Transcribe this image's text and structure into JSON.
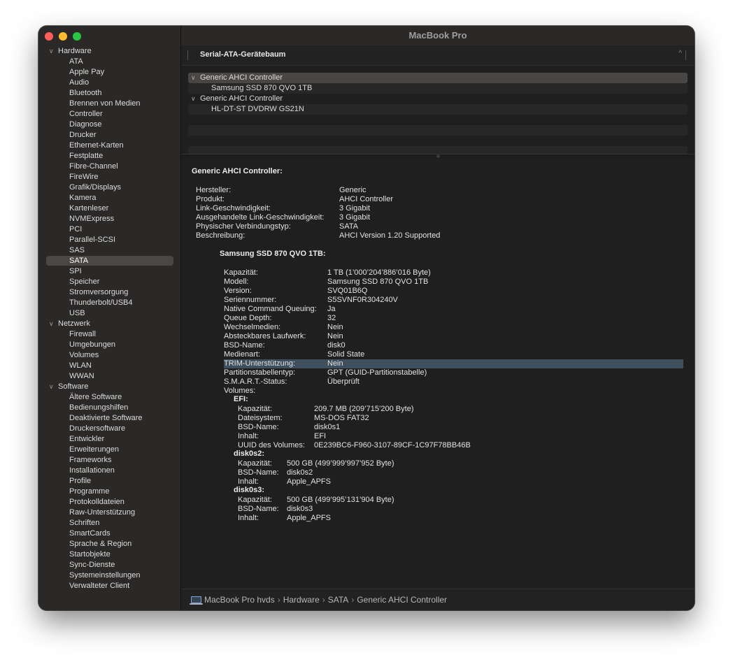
{
  "window": {
    "title": "MacBook Pro"
  },
  "sidebar": {
    "sections": [
      {
        "label": "Hardware",
        "items": [
          "ATA",
          "Apple Pay",
          "Audio",
          "Bluetooth",
          "Brennen von Medien",
          "Controller",
          "Diagnose",
          "Drucker",
          "Ethernet-Karten",
          "Festplatte",
          "Fibre-Channel",
          "FireWire",
          "Grafik/Displays",
          "Kamera",
          "Kartenleser",
          "NVMExpress",
          "PCI",
          "Parallel-SCSI",
          "SAS",
          "SATA",
          "SPI",
          "Speicher",
          "Stromversorgung",
          "Thunderbolt/USB4",
          "USB"
        ]
      },
      {
        "label": "Netzwerk",
        "items": [
          "Firewall",
          "Umgebungen",
          "Volumes",
          "WLAN",
          "WWAN"
        ]
      },
      {
        "label": "Software",
        "items": [
          "Ältere Software",
          "Bedienungshilfen",
          "Deaktivierte Software",
          "Druckersoftware",
          "Entwickler",
          "Erweiterungen",
          "Frameworks",
          "Installationen",
          "Profile",
          "Programme",
          "Protokolldateien",
          "Raw-Unterstützung",
          "Schriften",
          "SmartCards",
          "Sprache & Region",
          "Startobjekte",
          "Sync-Dienste",
          "Systemeinstellungen",
          "Verwalteter Client"
        ]
      }
    ],
    "selected": "SATA"
  },
  "tree_header": {
    "title": "Serial-ATA-Gerätebaum",
    "caret": "^"
  },
  "device_tree": [
    {
      "label": "Generic AHCI Controller",
      "level": 0,
      "selected": true
    },
    {
      "label": "Samsung SSD 870 QVO 1TB",
      "level": 1,
      "selected": false
    },
    {
      "label": "Generic AHCI Controller",
      "level": 0,
      "selected": false
    },
    {
      "label": "HL-DT-ST DVDRW  GS21N",
      "level": 1,
      "selected": false
    }
  ],
  "detail": {
    "controller_title": "Generic AHCI Controller:",
    "controller_props": [
      {
        "k": "Hersteller:",
        "v": "Generic"
      },
      {
        "k": "Produkt:",
        "v": "AHCI Controller"
      },
      {
        "k": "Link-Geschwindigkeit:",
        "v": "3 Gigabit"
      },
      {
        "k": "Ausgehandelte Link-Geschwindigkeit:",
        "v": "3 Gigabit"
      },
      {
        "k": "Physischer Verbindungstyp:",
        "v": "SATA"
      },
      {
        "k": "Beschreibung:",
        "v": "AHCI Version 1.20 Supported"
      }
    ],
    "disk_title": "Samsung SSD 870 QVO 1TB:",
    "disk_props": [
      {
        "k": "Kapazität:",
        "v": "1 TB (1’000’204’886’016 Byte)"
      },
      {
        "k": "Modell:",
        "v": "Samsung SSD 870 QVO 1TB"
      },
      {
        "k": "Version:",
        "v": "SVQ01B6Q"
      },
      {
        "k": "Seriennummer:",
        "v": "S5SVNF0R304240V"
      },
      {
        "k": "Native Command Queuing:",
        "v": "Ja"
      },
      {
        "k": "Queue Depth:",
        "v": "32"
      },
      {
        "k": "Wechselmedien:",
        "v": "Nein"
      },
      {
        "k": "Absteckbares Laufwerk:",
        "v": "Nein"
      },
      {
        "k": "BSD-Name:",
        "v": "disk0"
      },
      {
        "k": "Medienart:",
        "v": "Solid State"
      },
      {
        "k": "TRIM-Unterstützung:",
        "v": "Nein",
        "highlight": true
      },
      {
        "k": "Partitionstabellentyp:",
        "v": "GPT (GUID-Partitionstabelle)"
      },
      {
        "k": "S.M.A.R.T.-Status:",
        "v": "Überprüft"
      },
      {
        "k": "Volumes:",
        "v": ""
      }
    ],
    "volumes": [
      {
        "name": "EFI:",
        "props": [
          {
            "k": "Kapazität:",
            "v": "209.7 MB (209’715’200 Byte)"
          },
          {
            "k": "Dateisystem:",
            "v": "MS-DOS FAT32"
          },
          {
            "k": "BSD-Name:",
            "v": "disk0s1"
          },
          {
            "k": "Inhalt:",
            "v": "EFI"
          },
          {
            "k": "UUID des Volumes:",
            "v": "0E239BC6-F960-3107-89CF-1C97F78BB46B"
          }
        ]
      },
      {
        "name": "disk0s2:",
        "props": [
          {
            "k": "Kapazität:",
            "v": "500 GB (499’999’997’952 Byte)"
          },
          {
            "k": "BSD-Name:",
            "v": "disk0s2"
          },
          {
            "k": "Inhalt:",
            "v": "Apple_APFS"
          }
        ]
      },
      {
        "name": "disk0s3:",
        "props": [
          {
            "k": "Kapazität:",
            "v": "500 GB (499’995’131’904 Byte)"
          },
          {
            "k": "BSD-Name:",
            "v": "disk0s3"
          },
          {
            "k": "Inhalt:",
            "v": "Apple_APFS"
          }
        ]
      }
    ]
  },
  "statusbar": {
    "path": [
      "MacBook Pro hvds",
      "Hardware",
      "SATA",
      "Generic AHCI Controller"
    ],
    "separator": "›"
  }
}
